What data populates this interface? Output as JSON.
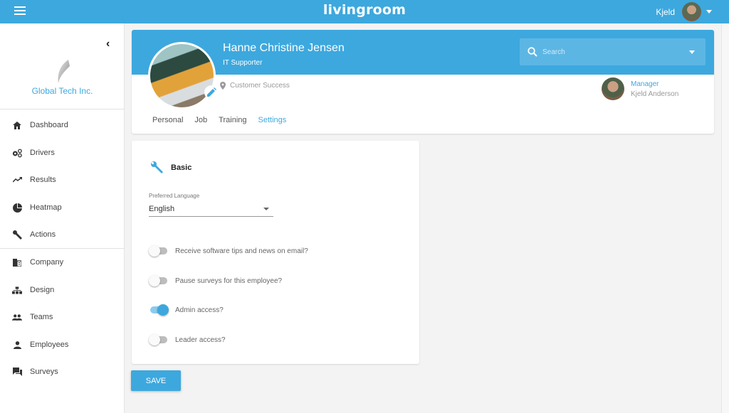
{
  "topbar": {
    "brand": "livingroom",
    "user_name": "Kjeld",
    "menu_icon": "hamburger-menu-icon",
    "user_menu_icon": "caret-down-icon"
  },
  "sidebar": {
    "company_name": "Global Tech Inc.",
    "collapse_icon": "chevron-left-icon",
    "groups": [
      {
        "items": [
          {
            "label": "Dashboard",
            "icon": "home-icon"
          },
          {
            "label": "Drivers",
            "icon": "gears-icon"
          },
          {
            "label": "Results",
            "icon": "trending-up-icon"
          },
          {
            "label": "Heatmap",
            "icon": "pie-chart-icon"
          },
          {
            "label": "Actions",
            "icon": "wrench-icon"
          }
        ]
      },
      {
        "items": [
          {
            "label": "Company",
            "icon": "building-icon"
          },
          {
            "label": "Design",
            "icon": "sitemap-icon"
          },
          {
            "label": "Teams",
            "icon": "people-icon"
          },
          {
            "label": "Employees",
            "icon": "person-icon"
          },
          {
            "label": "Surveys",
            "icon": "chat-icon"
          }
        ]
      }
    ]
  },
  "profile": {
    "name": "Hanne Christine Jensen",
    "role": "IT Supporter",
    "department": "Customer Success",
    "search_placeholder": "Search",
    "manager": {
      "label": "Manager",
      "name": "Kjeld Anderson"
    },
    "tabs": [
      {
        "label": "Personal",
        "active": false
      },
      {
        "label": "Job",
        "active": false
      },
      {
        "label": "Training",
        "active": false
      },
      {
        "label": "Settings",
        "active": true
      }
    ]
  },
  "settings": {
    "section_title": "Basic",
    "language": {
      "label": "Preferred Language",
      "value": "English"
    },
    "toggles": [
      {
        "label": "Receive software tips and news on email?",
        "on": false
      },
      {
        "label": "Pause surveys for this employee?",
        "on": false
      },
      {
        "label": "Admin access?",
        "on": true
      },
      {
        "label": "Leader access?",
        "on": false
      }
    ]
  },
  "actions": {
    "save_label": "SAVE"
  },
  "colors": {
    "accent": "#3da8de",
    "background": "#f3f3f3"
  }
}
